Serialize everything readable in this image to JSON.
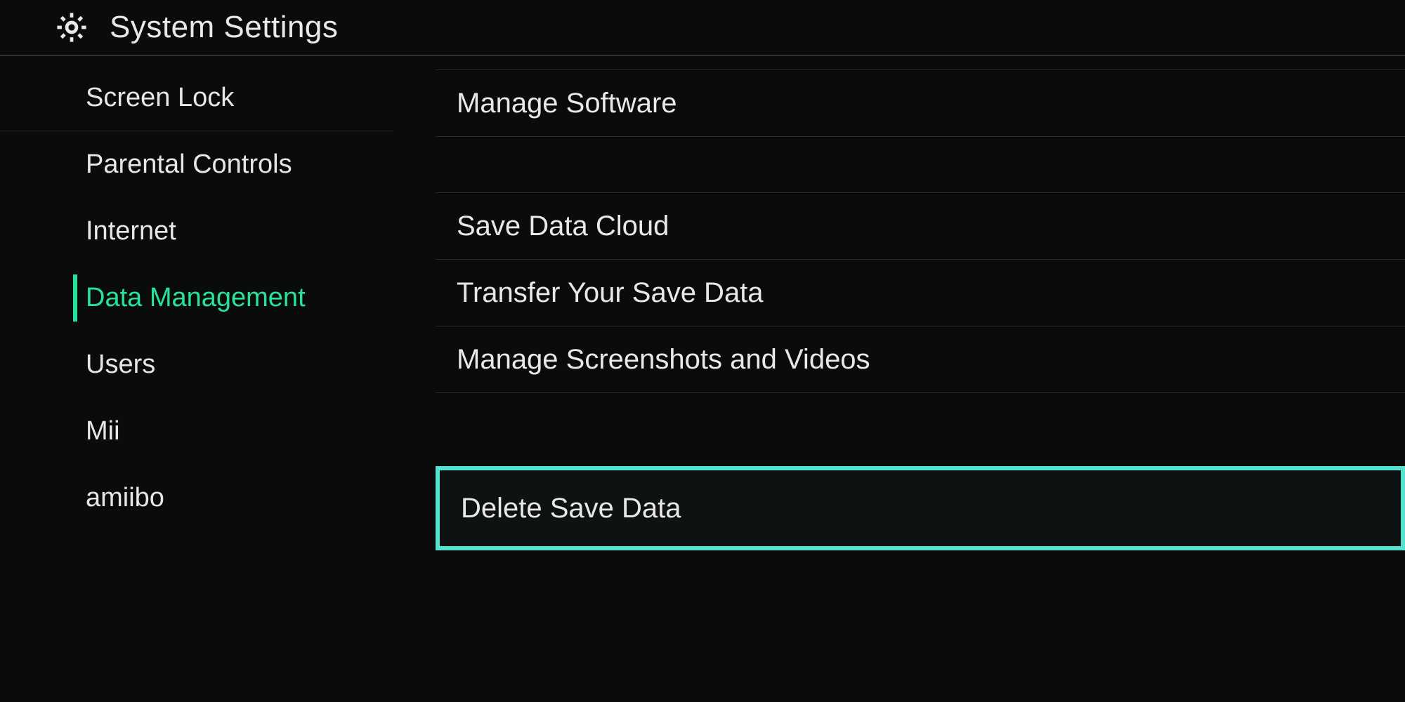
{
  "header": {
    "title": "System Settings"
  },
  "sidebar": {
    "items": [
      {
        "label": "Screen Lock",
        "active": false,
        "sep": true
      },
      {
        "label": "Parental Controls",
        "active": false,
        "sep": false
      },
      {
        "label": "Internet",
        "active": false,
        "sep": false
      },
      {
        "label": "Data Management",
        "active": true,
        "sep": false
      },
      {
        "label": "Users",
        "active": false,
        "sep": false
      },
      {
        "label": "Mii",
        "active": false,
        "sep": false
      },
      {
        "label": "amiibo",
        "active": false,
        "sep": false
      }
    ]
  },
  "content": {
    "items": [
      {
        "label": "Manage Software",
        "gapAfter": true
      },
      {
        "label": "Save Data Cloud",
        "gapAfter": false
      },
      {
        "label": "Transfer Your Save Data",
        "gapAfter": false
      },
      {
        "label": "Manage Screenshots and Videos",
        "gapAfter": true
      }
    ],
    "highlighted": {
      "label": "Delete Save Data"
    }
  },
  "colors": {
    "accent": "#28e29c",
    "highlightBorder": "#55e3cf",
    "background": "#0a0c0c",
    "divider": "#2a2c2c",
    "text": "#e8e8e8"
  }
}
